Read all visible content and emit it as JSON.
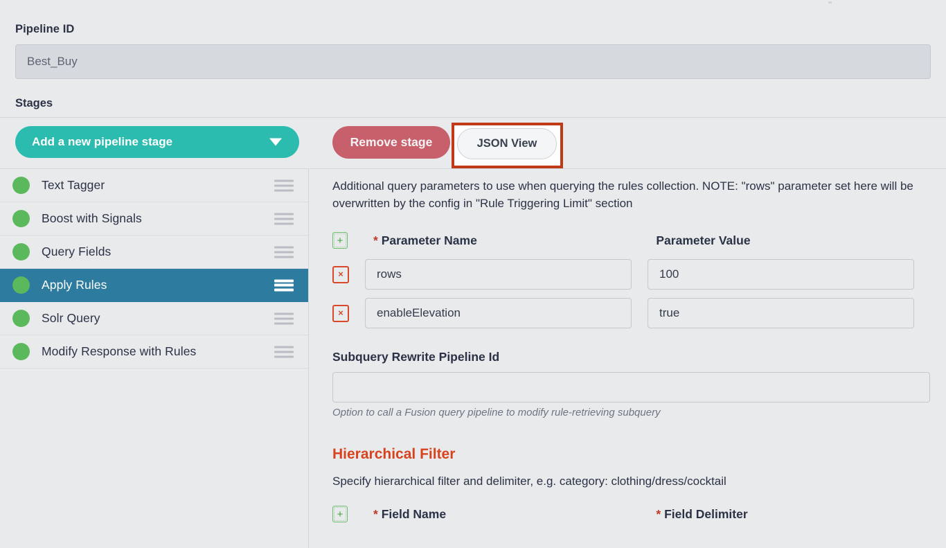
{
  "header": {
    "pipeline_id_label": "Pipeline ID",
    "pipeline_id_value": "Best_Buy",
    "stages_label": "Stages"
  },
  "toolbar": {
    "add_stage_label": "Add a new pipeline stage",
    "remove_stage_label": "Remove stage",
    "json_view_label": "JSON View",
    "highlight_color": "#c03a17"
  },
  "sidebar": {
    "stages": [
      {
        "label": "Text Tagger",
        "status_color": "#5cb85c",
        "active": false
      },
      {
        "label": "Boost with Signals",
        "status_color": "#5cb85c",
        "active": false
      },
      {
        "label": "Query Fields",
        "status_color": "#5cb85c",
        "active": false
      },
      {
        "label": "Apply Rules",
        "status_color": "#5cb85c",
        "active": true
      },
      {
        "label": "Solr Query",
        "status_color": "#5cb85c",
        "active": false
      },
      {
        "label": "Modify Response with Rules",
        "status_color": "#5cb85c",
        "active": false
      }
    ]
  },
  "main": {
    "description": "Additional query parameters to use when querying the rules collection. NOTE: \"rows\" parameter set here will be overwritten by the config in \"Rule Triggering Limit\" section",
    "param_table": {
      "add_label": "+",
      "delete_label": "×",
      "col_name_header": "Parameter Name",
      "col_name_required": "*",
      "col_value_header": "Parameter Value",
      "rows": [
        {
          "name": "rows",
          "value": "100"
        },
        {
          "name": "enableElevation",
          "value": "true"
        }
      ]
    },
    "subquery": {
      "label": "Subquery Rewrite Pipeline Id",
      "value": "",
      "hint": "Option to call a Fusion query pipeline to modify rule-retrieving subquery"
    },
    "hierarchical_filter": {
      "title": "Hierarchical Filter",
      "title_color": "#d8431f",
      "subtitle": "Specify hierarchical filter and delimiter, e.g. category: clothing/dress/cocktail",
      "add_label": "+",
      "col_field_name": "Field Name",
      "col_field_name_required": "*",
      "col_field_delimiter": "Field Delimiter",
      "col_field_delimiter_required": "*"
    }
  }
}
